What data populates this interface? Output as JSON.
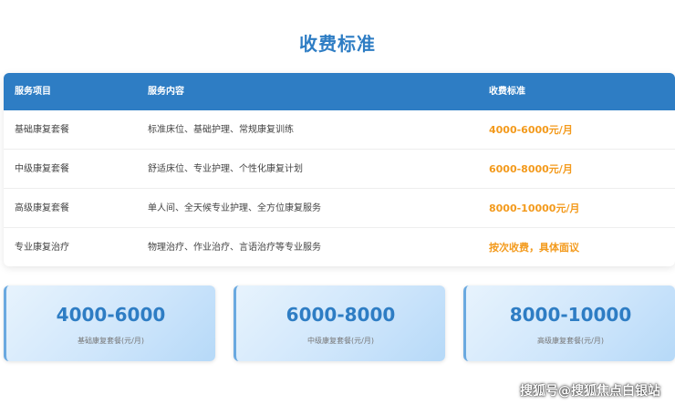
{
  "page_title": "收费标准",
  "table": {
    "headers": [
      "服务项目",
      "服务内容",
      "收费标准"
    ],
    "rows": [
      [
        "基础康复套餐",
        "标准床位、基础护理、常规康复训练",
        "4000-6000元/月"
      ],
      [
        "中级康复套餐",
        "舒适床位、专业护理、个性化康复计划",
        "6000-8000元/月"
      ],
      [
        "高级康复套餐",
        "单人间、全天候专业护理、全方位康复服务",
        "8000-10000元/月"
      ],
      [
        "专业康复治疗",
        "物理治疗、作业治疗、言语治疗等专业服务",
        "按次收费，具体面议"
      ]
    ]
  },
  "cards": [
    {
      "value": "4000-6000",
      "label": "基础康复套餐(元/月)"
    },
    {
      "value": "6000-8000",
      "label": "中级康复套餐(元/月)"
    },
    {
      "value": "8000-10000",
      "label": "高级康复套餐(元/月)"
    }
  ],
  "watermark": "搜狐号@搜狐焦点白银站",
  "colors": {
    "accent": "#2e7dc4",
    "price": "#f39a1c",
    "card_gradient_start": "#e7f3fd",
    "card_gradient_end": "#b6d9f8"
  }
}
